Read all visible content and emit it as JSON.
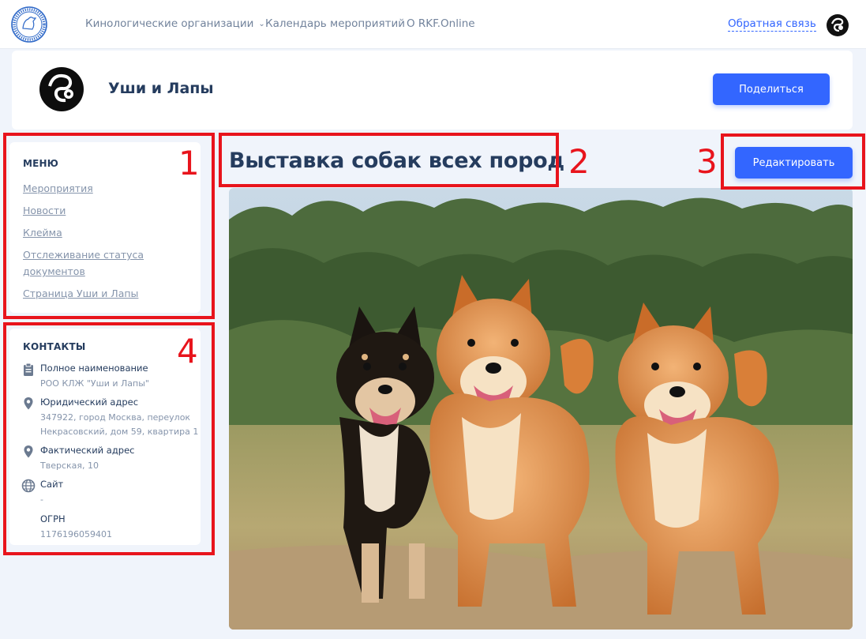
{
  "nav": {
    "items": [
      {
        "label": "Кинологические организации",
        "has_dropdown": true
      },
      {
        "label": "Календарь мероприятий"
      },
      {
        "label": "О RKF.Online"
      }
    ],
    "feedback": "Обратная связь"
  },
  "profile": {
    "name": "Уши и Лапы",
    "share_label": "Поделиться"
  },
  "menu": {
    "title": "МЕНЮ",
    "items": [
      "Мероприятия",
      "Новости",
      "Клейма",
      "Отслеживание статуса документов",
      "Страница Уши и Лапы"
    ]
  },
  "contacts": {
    "title": "КОНТАКТЫ",
    "items": [
      {
        "icon": "clipboard-icon",
        "label": "Полное наименование",
        "value": "РОО КЛЖ \"Уши и Лапы\""
      },
      {
        "icon": "location-pin-icon",
        "label": "Юридический адрес",
        "value": "347922, город Москва, переулок Некрасовский, дом 59, квартира 1"
      },
      {
        "icon": "location-pin-icon",
        "label": "Фактический адрес",
        "value": "Тверская, 10"
      },
      {
        "icon": "globe-icon",
        "label": "Сайт",
        "value": "-"
      },
      {
        "icon": "",
        "label": "ОГРН",
        "value": "1176196059401"
      }
    ]
  },
  "event": {
    "title": "Выставка собак всех пород",
    "edit_label": "Редактировать",
    "image": "three-shiba-inu-dogs-photo"
  },
  "annotations": [
    "1",
    "2",
    "3",
    "4"
  ],
  "colors": {
    "accent": "#3366ff",
    "text_dark": "#253c5e",
    "text_muted": "#8594ab",
    "annotation": "#e8141c",
    "page_bg": "#f0f4fb"
  }
}
